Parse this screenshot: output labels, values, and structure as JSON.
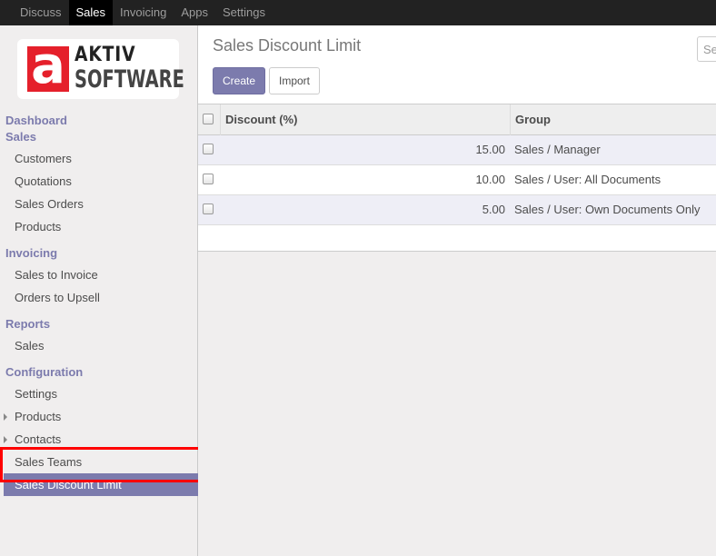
{
  "topbar": {
    "menu": [
      {
        "label": "Discuss"
      },
      {
        "label": "Sales",
        "active": true
      },
      {
        "label": "Invoicing"
      },
      {
        "label": "Apps"
      },
      {
        "label": "Settings"
      }
    ]
  },
  "logo": {
    "letter": "a",
    "line1": "AKTIV",
    "line2": "SOFTWARE",
    "brand_color": "#e5202b"
  },
  "sidebar": {
    "dashboard": "Dashboard",
    "sales_head": "Sales",
    "sales_items": [
      "Customers",
      "Quotations",
      "Sales Orders",
      "Products"
    ],
    "invoicing_head": "Invoicing",
    "invoicing_items": [
      "Sales to Invoice",
      "Orders to Upsell"
    ],
    "reports_head": "Reports",
    "reports_items": [
      "Sales"
    ],
    "configuration_head": "Configuration",
    "configuration_items": [
      "Settings",
      "Products",
      "Contacts",
      "Sales Teams",
      "Sales Discount Limit"
    ],
    "active_item": "Sales Discount Limit",
    "accent_color": "#7c7bad"
  },
  "main": {
    "title": "Sales Discount Limit",
    "create_label": "Create",
    "import_label": "Import",
    "search_placeholder": "Se",
    "columns": [
      "Discount (%)",
      "Group"
    ],
    "rows": [
      {
        "discount": "15.00",
        "group": "Sales / Manager"
      },
      {
        "discount": "10.00",
        "group": "Sales / User: All Documents"
      },
      {
        "discount": "5.00",
        "group": "Sales / User: Own Documents Only"
      }
    ]
  }
}
